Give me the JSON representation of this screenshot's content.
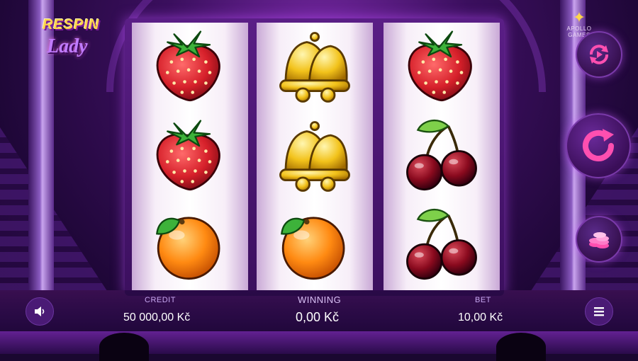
{
  "game": {
    "logo_line1": "RESPIN",
    "logo_line2": "Lady",
    "provider": "APOLLO GAMES"
  },
  "reels": [
    [
      "strawberry-icon",
      "strawberry-icon",
      "orange-icon"
    ],
    [
      "bells-icon",
      "bells-icon",
      "orange-icon"
    ],
    [
      "strawberry-icon",
      "cherries-icon",
      "cherries-icon"
    ]
  ],
  "panel": {
    "credit_label": "CREDIT",
    "credit_value": "50 000,00 Kč",
    "winning_label": "WINNING",
    "winning_value": "0,00 Kč",
    "bet_label": "BET",
    "bet_value": "10,00 Kč"
  },
  "buttons": {
    "autoplay": "autoplay-icon",
    "spin": "spin-icon",
    "bet": "coins-icon",
    "sound": "speaker-icon",
    "menu": "menu-icon"
  },
  "colors": {
    "accent": "#ff4fb0",
    "panel_label": "#c6a7f0",
    "logo_gold": "#ffd54a"
  }
}
